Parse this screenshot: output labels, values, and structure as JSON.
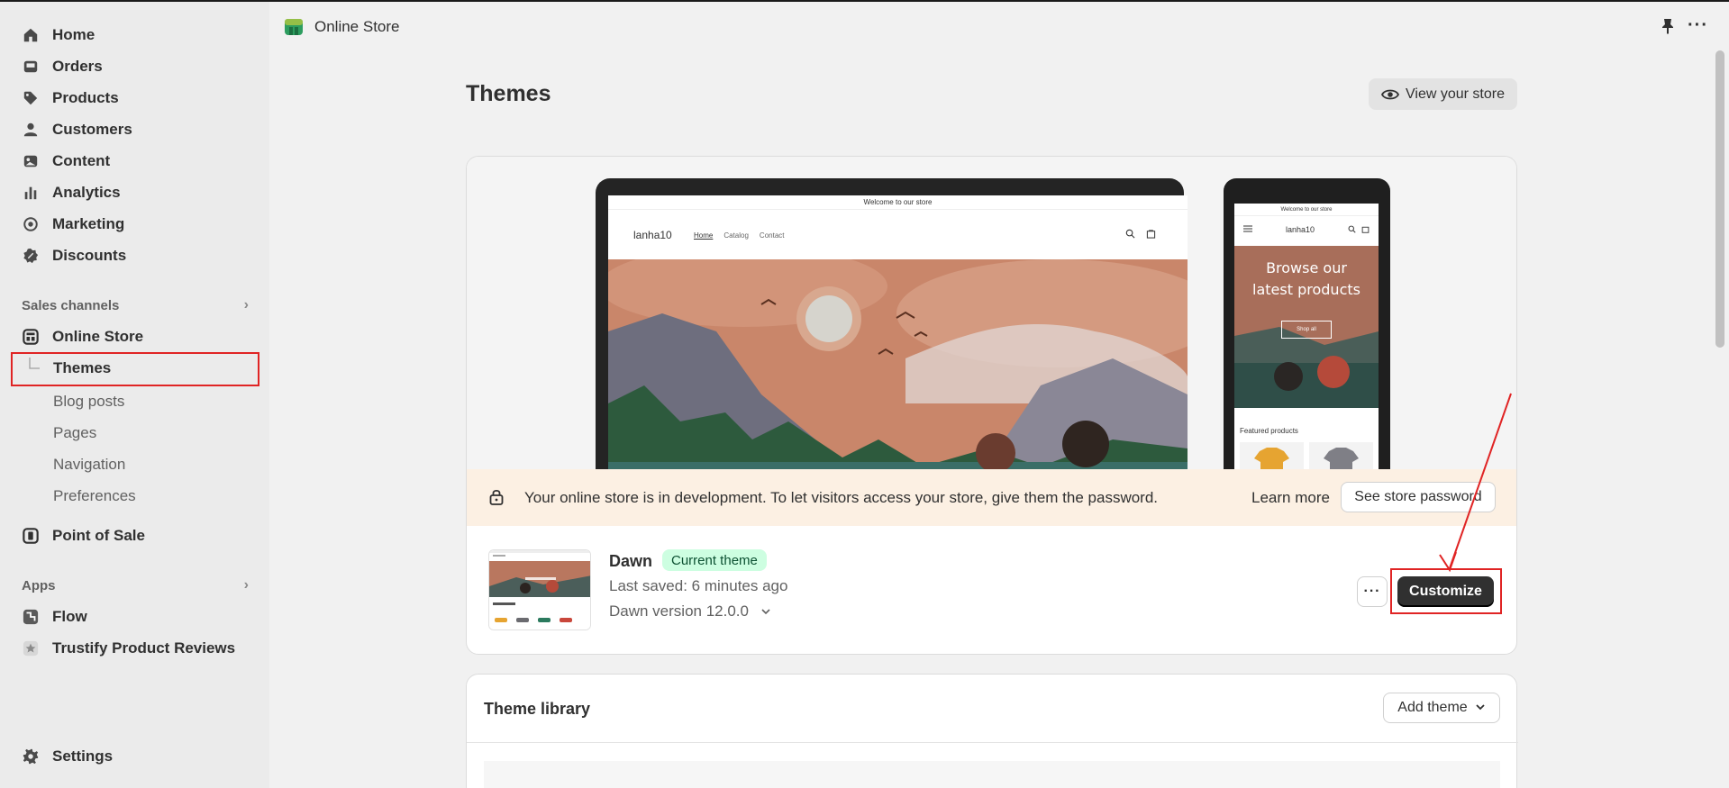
{
  "sidebar": {
    "main_items": [
      {
        "label": "Home",
        "icon": "home-icon"
      },
      {
        "label": "Orders",
        "icon": "inbox-icon"
      },
      {
        "label": "Products",
        "icon": "tag-icon"
      },
      {
        "label": "Customers",
        "icon": "person-icon"
      },
      {
        "label": "Content",
        "icon": "image-icon"
      },
      {
        "label": "Analytics",
        "icon": "bar-chart-icon"
      },
      {
        "label": "Marketing",
        "icon": "target-icon"
      },
      {
        "label": "Discounts",
        "icon": "discount-icon"
      }
    ],
    "sales_channels": {
      "heading": "Sales channels",
      "online_store": "Online Store",
      "themes": "Themes",
      "sub_items": [
        "Blog posts",
        "Pages",
        "Navigation",
        "Preferences"
      ],
      "point_of_sale": "Point of Sale"
    },
    "apps": {
      "heading": "Apps",
      "items": [
        "Flow",
        "Trustify Product Reviews"
      ]
    },
    "settings": "Settings"
  },
  "topbar": {
    "title": "Online Store"
  },
  "page": {
    "title": "Themes",
    "view_store": "View your store"
  },
  "preview": {
    "announcement": "Welcome to our store",
    "brand": "lanha10",
    "nav_links": [
      "Home",
      "Catalog",
      "Contact"
    ],
    "mobile_hero_line1": "Browse our",
    "mobile_hero_line2": "latest products",
    "mobile_shop_all": "Shop all",
    "featured": "Featured products"
  },
  "banner": {
    "message": "Your online store is in development. To let visitors access your store, give them the password.",
    "learn_more": "Learn more",
    "see_password": "See store password"
  },
  "current_theme": {
    "name": "Dawn",
    "badge": "Current theme",
    "last_saved": "Last saved: 6 minutes ago",
    "version": "Dawn version 12.0.0",
    "customize": "Customize"
  },
  "library": {
    "title": "Theme library",
    "add_theme": "Add theme"
  },
  "colors": {
    "annotation": "#e02424",
    "badge_bg": "#cdfee1",
    "banner_bg": "#fcf0e3",
    "primary_button": "#303030"
  }
}
